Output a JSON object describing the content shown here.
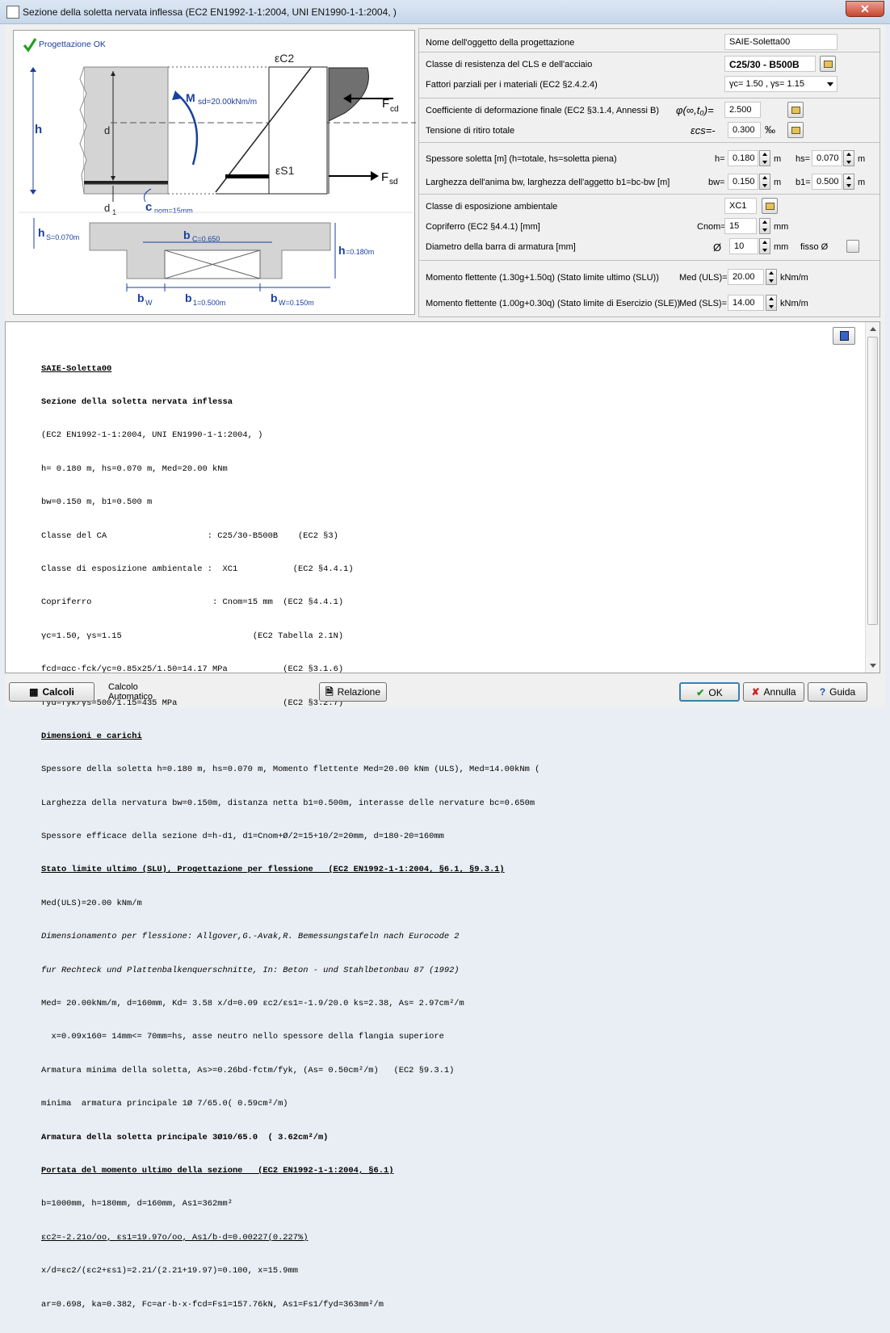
{
  "window": {
    "title": "Sezione della soletta nervata inflessa (EC2 EN1992-1-1:2004, UNI EN1990-1-1:2004, )",
    "close_glyph": "✕"
  },
  "drawing": {
    "status": "Progettazione OK",
    "labels": {
      "ec2": "εC2",
      "es1": "εS1",
      "msd": "M",
      "msd_sub": "sd=20.00kNm/m",
      "fcd": "F",
      "fcd_sub": "cd",
      "fsd": "F",
      "fsd_sub": "sd",
      "h": "h",
      "d": "d",
      "d1": "d",
      "d1_sub": "1",
      "cnom": "c",
      "cnom_sub": "nom=15mm",
      "hs": "h",
      "hs_sub": "S=0.070m",
      "bc": "b",
      "bc_sub": "C=0.650",
      "h2": "h",
      "h2_sub": "=0.180m",
      "bw1": "b",
      "bw1_sub": "W",
      "b1": "b",
      "b1_sub": "1=0.500m",
      "bw2": "b",
      "bw2_sub": "W=0.150m"
    }
  },
  "inputs": {
    "name_label": "Nome dell'oggetto della progettazione",
    "name_value": "SAIE-Soletta00",
    "class_label": "Classe di resistenza del CLS e dell'acciaio",
    "class_value": "C25/30 - B500B",
    "factors_label": "Fattori parziali per i materiali (EC2 §2.4.2.4)",
    "factors_value": "γc=  1.50 , γs=  1.15",
    "creep_label": "Coefficiente di deformazione finale (EC2 §3.1.4, Annessi B)",
    "creep_symbol": "φ(∞,t₀)=",
    "creep_value": "2.500",
    "shrink_label": "Tensione di ritiro totale",
    "shrink_symbol": "εcs=-",
    "shrink_value": "0.300",
    "shrink_unit": "‰",
    "thick_label": "Spessore soletta [m] (h=totale, hs=soletta piena)",
    "h_label": "h=",
    "h_value": "0.180",
    "hs_label": "hs=",
    "hs_value": "0.070",
    "unit_m": "m",
    "width_label": "Larghezza dell'anima bw, larghezza dell'aggetto b1=bc-bw [m]",
    "bw_label": "bw=",
    "bw_value": "0.150",
    "b1_label": "b1=",
    "b1_value": "0.500",
    "exp_label": "Classe di esposizione ambientale",
    "exp_value": "XC1",
    "cover_label": "Copriferro (EC2 §4.4.1) [mm]",
    "cnom_label": "Cnom=",
    "cnom_value": "15",
    "unit_mm": "mm",
    "bar_label": "Diametro della barra di armatura [mm]",
    "bar_symbol": "Ø",
    "bar_value": "10",
    "fixed_label": "fisso Ø",
    "mslu_label": "Momento flettente (1.30g+1.50q) (Stato limite ultimo (SLU))",
    "mslu_field": "Med (ULS)=",
    "mslu_value": "20.00",
    "msle_label": "Momento flettente (1.00g+0.30q) (Stato limite di Esercizio (SLE))",
    "msle_field": "Med (SLS)=",
    "msle_value": "14.00",
    "unit_knm": "kNm/m"
  },
  "report": {
    "lines": [
      "SAIE-Soletta00",
      "Sezione della soletta nervata inflessa",
      "(EC2 EN1992-1-1:2004, UNI EN1990-1-1:2004, )",
      "h= 0.180 m, hs=0.070 m, Med=20.00 kNm",
      "bw=0.150 m, b1=0.500 m",
      "Classe del CA                    : C25/30-B500B    (EC2 §3)",
      "Classe di esposizione ambientale :  XC1           (EC2 §4.4.1)",
      "Copriferro                        : Cnom=15 mm  (EC2 §4.4.1)",
      "γc=1.50, γs=1.15                          (EC2 Tabella 2.1N)",
      "fcd=αcc·fck/γc=0.85x25/1.50=14.17 MPa           (EC2 §3.1.6)",
      "fyd=fyk/γs=500/1.15=435 MPa                     (EC2 §3.2.7)",
      "Dimensioni e carichi",
      "Spessore della soletta h=0.180 m, hs=0.070 m, Momento flettente Med=20.00 kNm (ULS), Med=14.00kNm (",
      "Larghezza della nervatura bw=0.150m, distanza netta b1=0.500m, interasse delle nervature bc=0.650m",
      "Spessore efficace della sezione d=h-d1, d1=Cnom+Ø/2=15+10/2=20mm, d=180-20=160mm",
      "Stato limite ultimo (SLU), Progettazione per flessione   (EC2 EN1992-1-1:2004, §6.1, §9.3.1)",
      "Med(ULS)=20.00 kNm/m",
      "Dimensionamento per flessione: Allgover,G.-Avak,R. Bemessungstafeln nach Eurocode 2",
      "fur Rechteck und Plattenbalkenquerschnitte, In: Beton - und Stahlbetonbau 87 (1992)",
      "Med= 20.00kNm/m, d=160mm, Kd= 3.58 x/d=0.09 εc2/εs1=-1.9/20.0 ks=2.38, As= 2.97cm²/m",
      "  x=0.09x160= 14mm<= 70mm=hs, asse neutro nello spessore della flangia superiore",
      "Armatura minima della soletta, As>=0.26bd·fctm/fyk, (As= 0.50cm²/m)   (EC2 §9.3.1)",
      "minima  armatura principale 1Ø 7/65.0( 0.59cm²/m)",
      "Armatura della soletta principale 3Ø10/65.0  ( 3.62cm²/m)",
      "Portata del momento ultimo della sezione   (EC2 EN1992-1-1:2004, §6.1)",
      "b=1000mm, h=180mm, d=160mm, As1=362mm²",
      "εc2=-2.21o/oo, εs1=19.97o/oo, As1/b·d=0.00227(0.227%)",
      "x/d=εc2/(εc2+εs1)=2.21/(2.21+19.97)=0.100, x=15.9mm",
      "ar=0.698, ka=0.382, Fc=ar·b·x·fcd=Fs1=157.76kN, As1=Fs1/fyd=363mm²/m"
    ]
  },
  "buttons": {
    "calcoli": "Calcoli",
    "calc_auto_1": "Calcolo",
    "calc_auto_2": "Automatico",
    "relazione": "Relazione",
    "ok": "OK",
    "annulla": "Annulla",
    "guida": "Guida"
  }
}
